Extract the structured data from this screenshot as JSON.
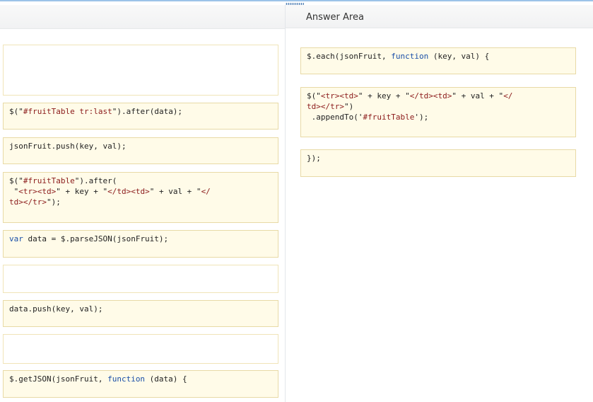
{
  "answer_area": {
    "title": "Answer Area"
  },
  "source_tiles": [
    {
      "type": "code",
      "segments": [
        [
          "plain",
          "$(\""
        ],
        [
          "str",
          "#fruitTable tr:last"
        ],
        [
          "plain",
          "\").after(data);"
        ]
      ]
    },
    {
      "type": "code",
      "segments": [
        [
          "plain",
          "jsonFruit.push(key, val);"
        ]
      ]
    },
    {
      "type": "code",
      "segments": [
        [
          "plain",
          "$(\""
        ],
        [
          "str",
          "#fruitTable"
        ],
        [
          "plain",
          "\").after(\n \""
        ],
        [
          "str",
          "<tr><td>"
        ],
        [
          "plain",
          "\" + key + \""
        ],
        [
          "str",
          "</td><td>"
        ],
        [
          "plain",
          "\" + val + \""
        ],
        [
          "str",
          "</\ntd></tr>"
        ],
        [
          "plain",
          "\");"
        ]
      ]
    },
    {
      "type": "code",
      "segments": [
        [
          "kw",
          "var"
        ],
        [
          "plain",
          " data = $.parseJSON(jsonFruit);"
        ]
      ]
    },
    {
      "type": "code",
      "segments": [
        [
          "plain",
          "data.push(key, val);"
        ]
      ]
    },
    {
      "type": "code",
      "segments": [
        [
          "plain",
          "$.getJSON(jsonFruit, "
        ],
        [
          "kw",
          "function"
        ],
        [
          "plain",
          " (data) {"
        ]
      ]
    }
  ],
  "answer_tiles": [
    {
      "type": "code",
      "segments": [
        [
          "plain",
          "$.each(jsonFruit, "
        ],
        [
          "kw",
          "function"
        ],
        [
          "plain",
          " (key, val) {"
        ]
      ]
    },
    {
      "type": "code",
      "segments": [
        [
          "plain",
          "$(\""
        ],
        [
          "str",
          "<tr><td>"
        ],
        [
          "plain",
          "\" + key + \""
        ],
        [
          "str",
          "</td><td>"
        ],
        [
          "plain",
          "\" + val + \""
        ],
        [
          "str",
          "</\ntd></tr>"
        ],
        [
          "plain",
          "\")\n .appendTo('"
        ],
        [
          "str",
          "#fruitTable"
        ],
        [
          "plain",
          "');"
        ]
      ]
    },
    {
      "type": "code",
      "segments": [
        [
          "plain",
          "});"
        ]
      ]
    }
  ]
}
